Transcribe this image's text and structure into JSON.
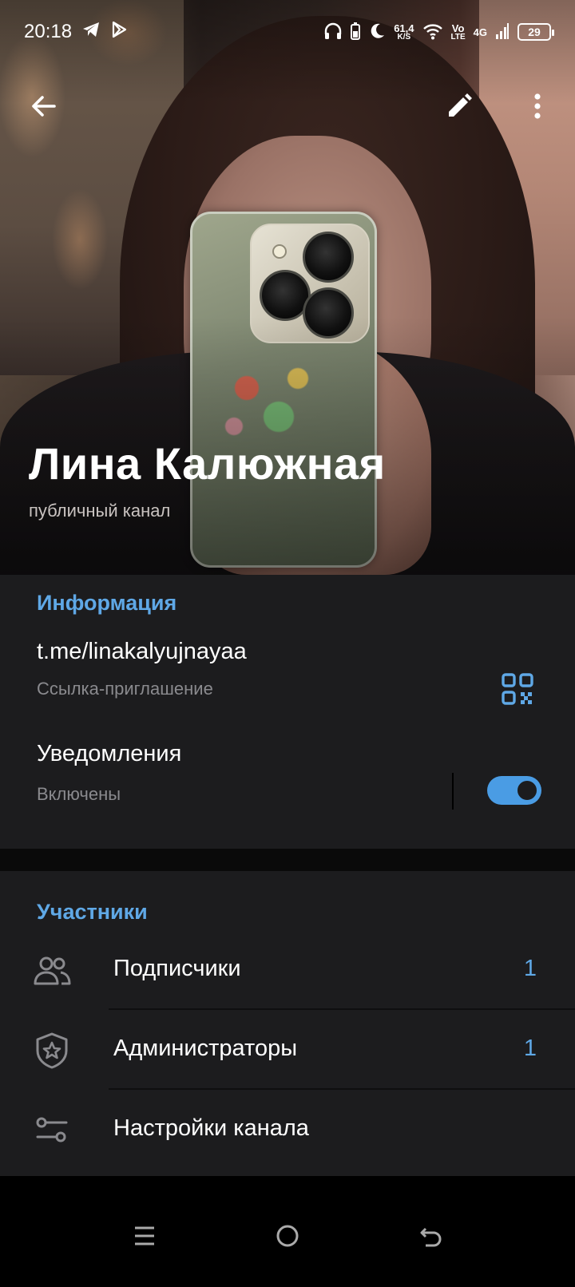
{
  "status_bar": {
    "time": "20:18",
    "speed_value": "61,4",
    "speed_unit": "K/S",
    "volte_top": "Vo",
    "volte_bottom": "LTE",
    "network": "4G",
    "battery": "29"
  },
  "toolbar": {
    "back_icon": "arrow-left-icon",
    "edit_icon": "pencil-icon",
    "more_icon": "more-vertical-icon"
  },
  "profile": {
    "name": "Лина Калюжная",
    "subtitle": "публичный канал"
  },
  "info": {
    "header": "Информация",
    "link": "t.me/linakalyujnayaa",
    "link_caption": "Ссылка-приглашение",
    "notifications_title": "Уведомления",
    "notifications_status": "Включены",
    "notifications_enabled": true
  },
  "members": {
    "header": "Участники",
    "items": [
      {
        "label": "Подписчики",
        "count": "1",
        "icon": "users-icon"
      },
      {
        "label": "Администраторы",
        "count": "1",
        "icon": "shield-star-icon"
      },
      {
        "label": "Настройки канала",
        "count": "",
        "icon": "sliders-icon"
      }
    ]
  },
  "colors": {
    "accent": "#5fa8e6",
    "section_bg": "#1c1c1e",
    "secondary_text": "#8a8a8e"
  }
}
